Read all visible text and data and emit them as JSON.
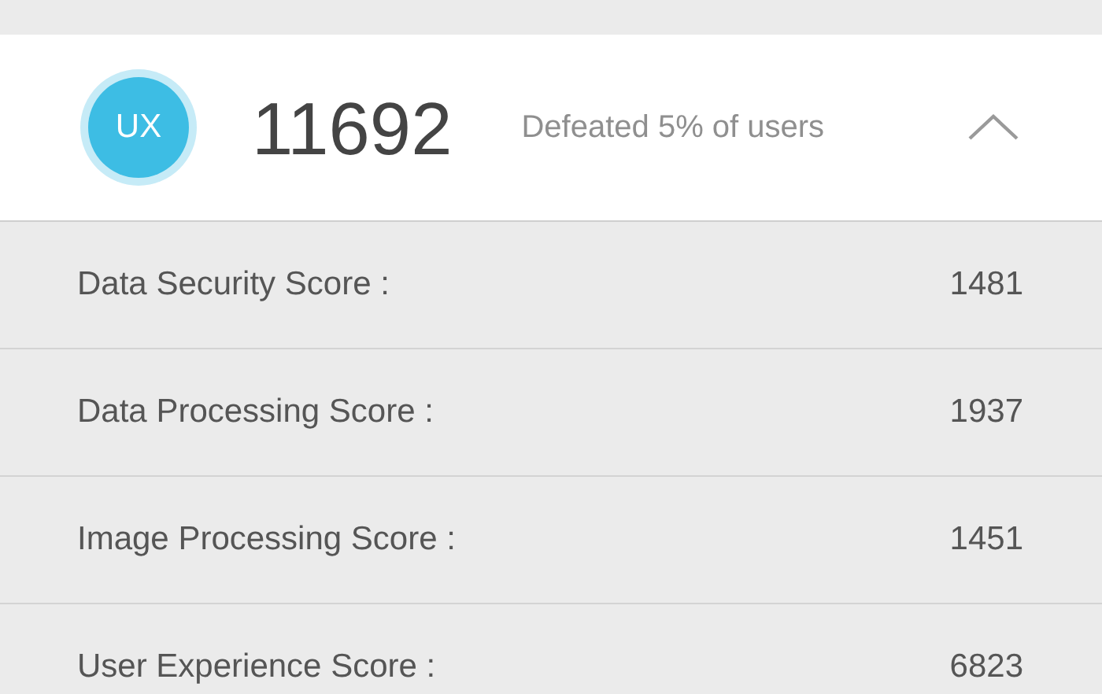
{
  "summary": {
    "badge": "UX",
    "score": "11692",
    "note": "Defeated 5% of users",
    "expanded": true
  },
  "rows": [
    {
      "label": "Data Security Score :",
      "value": "1481"
    },
    {
      "label": "Data Processing Score :",
      "value": "1937"
    },
    {
      "label": "Image Processing Score :",
      "value": "1451"
    },
    {
      "label": "User Experience Score :",
      "value": "6823"
    }
  ]
}
